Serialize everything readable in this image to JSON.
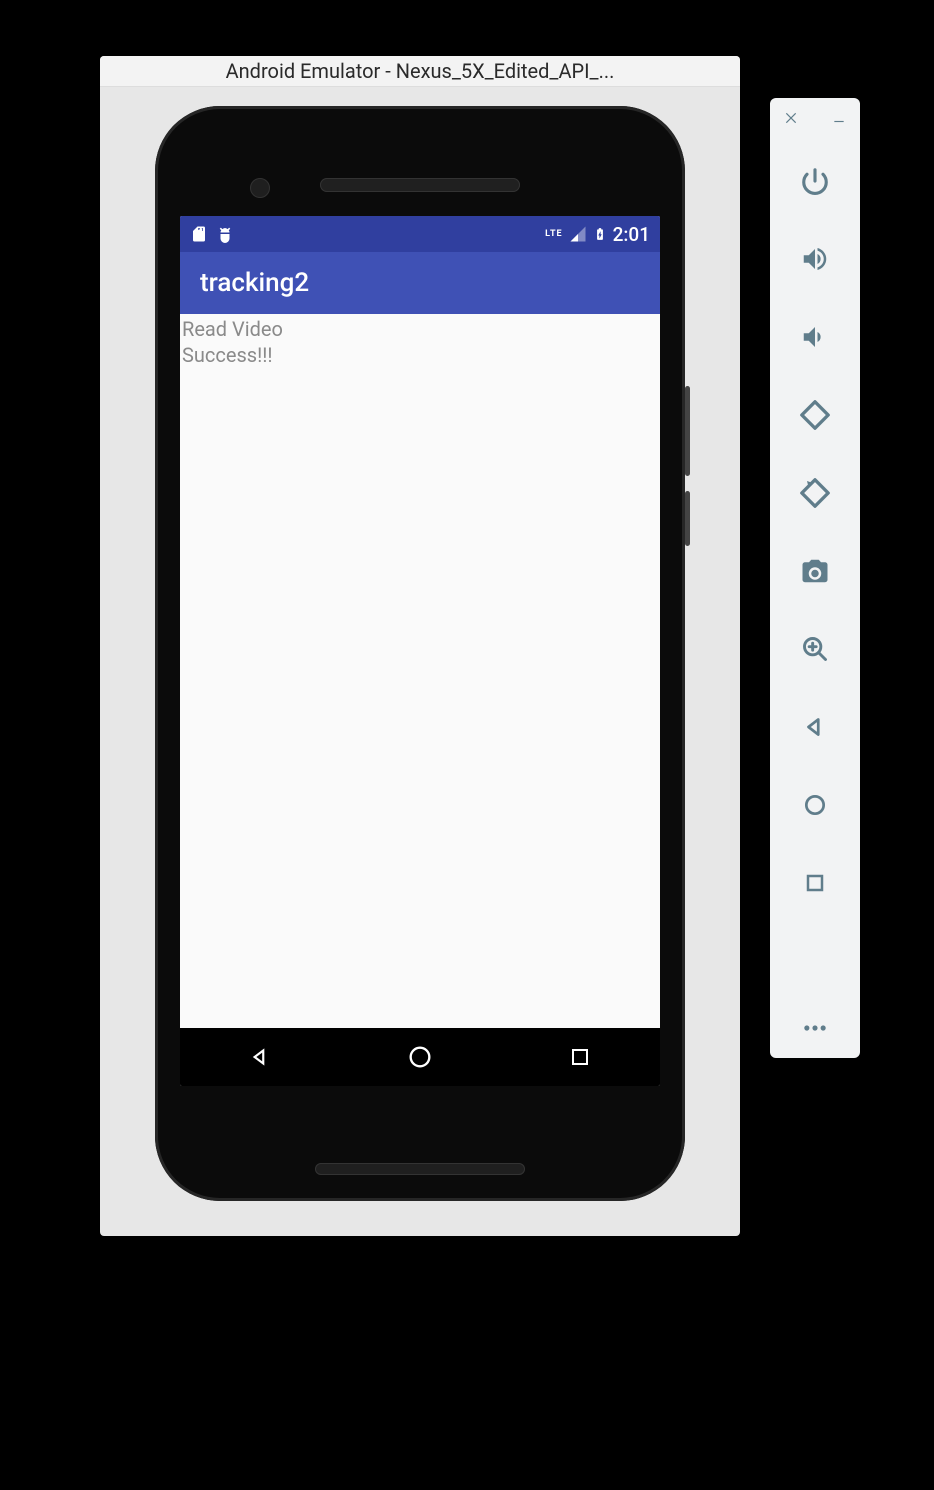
{
  "window": {
    "title": "Android Emulator - Nexus_5X_Edited_API_..."
  },
  "statusbar": {
    "lte": "LTE",
    "time": "2:01"
  },
  "appbar": {
    "title": "tracking2"
  },
  "content": {
    "line1": "Read Video",
    "line2": "Success!!!"
  },
  "colors": {
    "primary": "#3f51b5",
    "primaryDark": "#303f9f",
    "toolbarIcon": "#607d8b"
  }
}
